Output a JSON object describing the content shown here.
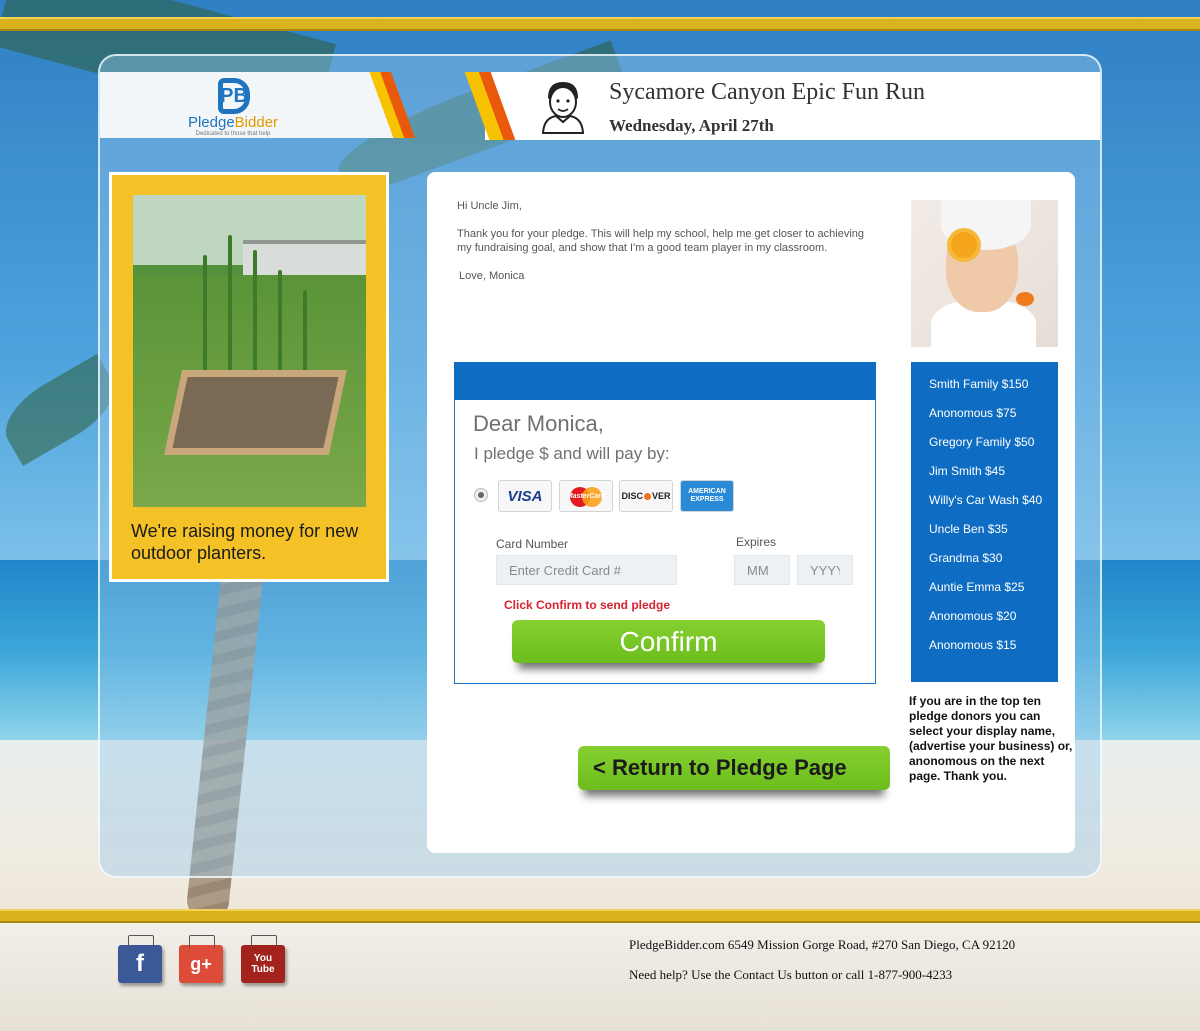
{
  "brand": {
    "logo_letters": "PB",
    "name_part1": "Pledge",
    "name_part2": "Bidder",
    "tagline": "Dedicated to those that help"
  },
  "event": {
    "title": "Sycamore Canyon Epic Fun Run",
    "date": "Wednesday, April 27th"
  },
  "project": {
    "caption": "We're raising money for new outdoor planters."
  },
  "letter": {
    "greeting": "Hi Uncle Jim,",
    "body": "Thank you for your pledge. This will help my school, help me get closer to achieving my fundraising goal, and show that I'm a good team player in my classroom.",
    "signoff": "Love, Monica"
  },
  "pledge_form": {
    "salutation": "Dear Monica,",
    "pledge_line": "I pledge $ and will pay by:",
    "cards": {
      "visa": "VISA",
      "mastercard": "MasterCard",
      "discover_left": "DISC",
      "discover_right": "VER",
      "amex_line1": "AMERICAN",
      "amex_line2": "EXPRESS"
    },
    "card_number_label": "Card Number",
    "card_number_placeholder": "Enter Credit Card #",
    "expires_label": "Expires",
    "month_placeholder": "MM",
    "year_placeholder": "YYYYY",
    "confirm_hint": "Click Confirm to send pledge",
    "confirm_label": "Confirm"
  },
  "return_button": "< Return to Pledge Page",
  "donors": [
    "Smith Family  $150",
    "Anonomous  $75",
    "Gregory Family $50",
    "Jim Smith  $45",
    "Willy's Car Wash $40",
    "Uncle Ben  $35",
    "Grandma $30",
    "Auntie Emma $25",
    "Anonomous  $20",
    "Anonomous  $15"
  ],
  "donor_note": "If you are in the top ten pledge donors you can select your display name, (advertise your business) or, anonomous on the next page. Thank you.",
  "social": {
    "facebook": "f",
    "google_plus": "g+",
    "youtube": "You Tube"
  },
  "footer": {
    "address": "PledgeBidder.com 6549 Mission Gorge Road, #270 San Diego, CA 92120",
    "help": "Need help?  Use the Contact Us button or call 1-877-900-4233"
  },
  "colors": {
    "brand_blue": "#0e6dc2",
    "accent_yellow": "#f4c226",
    "confirm_green": "#7ac72a",
    "hint_red": "#d6232f"
  }
}
